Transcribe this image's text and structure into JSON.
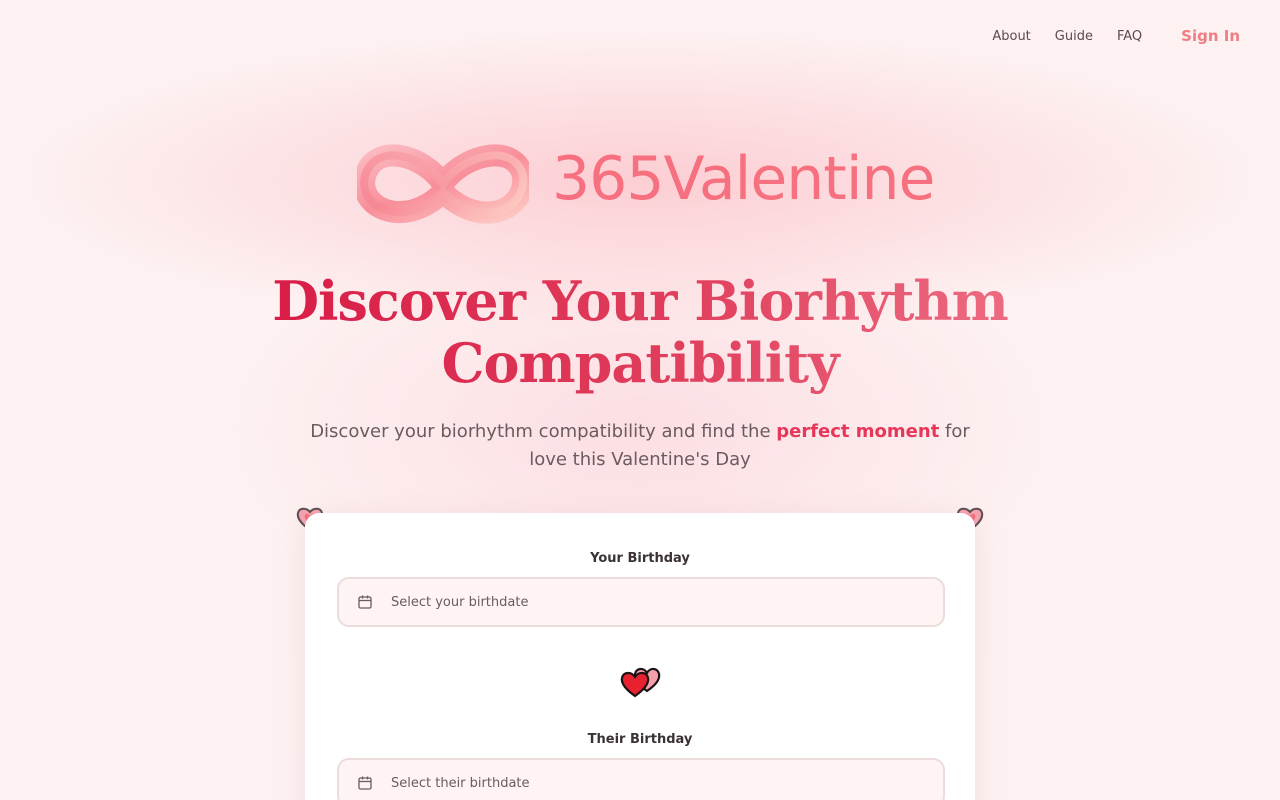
{
  "nav": {
    "links": [
      "About",
      "Guide",
      "FAQ"
    ],
    "sign_in": "Sign In"
  },
  "brand": {
    "name": "365Valentine",
    "icon": "infinity-logo-icon",
    "color": "#f6707f"
  },
  "hero": {
    "title_line1": "Discover Your Biorhythm",
    "title_line2": "Compatibility",
    "subtitle_before": "Discover your biorhythm compatibility and find the ",
    "subtitle_highlight": "perfect moment",
    "subtitle_after": " for love this Valentine's Day"
  },
  "form": {
    "your_birthday_label": "Your Birthday",
    "your_birthday_placeholder": "Select your birthdate",
    "their_birthday_label": "Their Birthday",
    "their_birthday_placeholder": "Select their birthdate",
    "divider_icon": "two-hearts-icon",
    "corner_icon": "heart-icon"
  },
  "colors": {
    "accent": "#e8365a",
    "headline_start": "#d81a45",
    "headline_end": "#ee6f84",
    "background": "#fdf1f1"
  }
}
